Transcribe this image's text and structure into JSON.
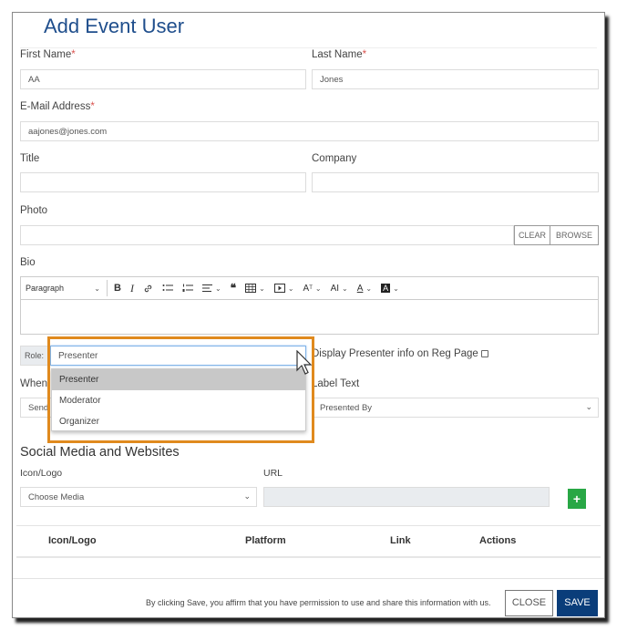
{
  "modal": {
    "title": "Add Event User"
  },
  "form": {
    "first_name": {
      "label": "First Name",
      "required_mark": "*",
      "value": "AA"
    },
    "last_name": {
      "label": "Last Name",
      "required_mark": "*",
      "value": "Jones"
    },
    "email": {
      "label": "E-Mail Address",
      "required_mark": "*",
      "value": "aajones@jones.com"
    },
    "title": {
      "label": "Title",
      "value": ""
    },
    "company": {
      "label": "Company",
      "value": ""
    },
    "photo": {
      "label": "Photo",
      "value": "",
      "clear_label": "CLEAR",
      "browse_label": "BROWSE"
    },
    "bio": {
      "label": "Bio",
      "toolbar": {
        "paragraph": "Paragraph",
        "bold": "B",
        "italic": "I",
        "link_icon": "link-icon",
        "bullet_list_icon": "bulleted-list-icon",
        "numbered_list_icon": "numbered-list-icon",
        "align_icon": "align-icon",
        "quote": "❝",
        "table_icon": "table-icon",
        "media_icon": "media-icon",
        "font_size": "A",
        "font_family": "AI",
        "font_color": "A",
        "bg_color": "A"
      },
      "value": ""
    },
    "role": {
      "addon": "Role:",
      "value": "Presenter",
      "options": [
        "Presenter",
        "Moderator",
        "Organizer"
      ],
      "selected_index": 0
    },
    "display_presenter": {
      "label": "Display Presenter info on Reg Page",
      "checked": false
    },
    "when": {
      "label": "When",
      "value": "Send"
    },
    "label_text": {
      "label": "Label Text",
      "value": "Presented By"
    }
  },
  "social": {
    "title": "Social Media and Websites",
    "icon_label": "Icon/Logo",
    "icon_placeholder": "Choose Media",
    "url_label": "URL",
    "url_value": "",
    "add_label": "+",
    "table_headers": [
      "Icon/Logo",
      "Platform",
      "Link",
      "Actions"
    ]
  },
  "footer": {
    "disclaimer": "By clicking Save, you affirm that you have permission to use and share this information with us.",
    "close_label": "CLOSE",
    "save_label": "SAVE"
  },
  "colors": {
    "title": "#1f4e8c",
    "required": "#d9534f",
    "highlight": "#e08a1e",
    "add_button": "#28a745",
    "save_button": "#0a3d7a"
  }
}
